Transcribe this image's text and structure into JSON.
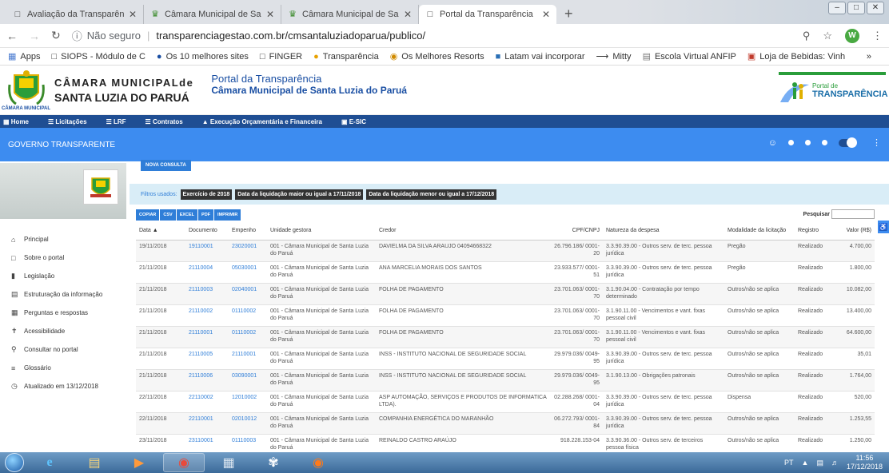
{
  "browser": {
    "tabs": [
      {
        "title": "Avaliação da Transparência dos M",
        "icon": "page-icon",
        "active": false
      },
      {
        "title": "Câmara Municipal de Santa Luzia",
        "icon": "crest-icon",
        "active": false
      },
      {
        "title": "Câmara Municipal de Santa Luzia",
        "icon": "crest-icon",
        "active": false
      },
      {
        "title": "Portal da Transparência",
        "icon": "page-icon",
        "active": true
      }
    ],
    "security_label": "Não seguro",
    "url": "transparenciagestao.com.br/cmsantaluziadoparua/publico/",
    "avatar_letter": "W",
    "bookmarks": [
      {
        "label": "Apps",
        "icon": "apps-icon"
      },
      {
        "label": "SIOPS - Módulo de C",
        "icon": "page-icon"
      },
      {
        "label": "Os 10 melhores sites",
        "icon": "globe-icon"
      },
      {
        "label": "FINGER",
        "icon": "page-icon"
      },
      {
        "label": "Transparência",
        "icon": "info-icon"
      },
      {
        "label": "Os Melhores Resorts",
        "icon": "resort-icon"
      },
      {
        "label": "Latam vai incorporar",
        "icon": "news-icon"
      },
      {
        "label": "Mitty",
        "icon": "arrow-icon"
      },
      {
        "label": "Escola Virtual ANFIP",
        "icon": "school-icon"
      },
      {
        "label": "Loja de Bebidas: Vinh",
        "icon": "store-icon"
      }
    ]
  },
  "header": {
    "org_line1": "CÂMARA MUNICIPALde",
    "org_line2": "SANTA LUZIA DO PARUÁ",
    "crest_caption": "CÂMARA MUNICIPAL",
    "portal_title": "Portal da Transparência",
    "portal_subtitle": "Câmara Municipal de Santa Luzia do Paruá",
    "brand_small": "Portal de",
    "brand_large": "TRANSPARÊNCIA"
  },
  "menu": {
    "items": [
      "Home",
      "Licitações",
      "LRF",
      "Contratos",
      "Execução Orçamentária e Financeira",
      "E-SIC"
    ]
  },
  "govbar": {
    "title": "GOVERNO TRANSPARENTE"
  },
  "sidebar": {
    "items": [
      {
        "label": "Principal",
        "icon": "home-icon"
      },
      {
        "label": "Sobre o portal",
        "icon": "folder-icon"
      },
      {
        "label": "Legislação",
        "icon": "document-icon"
      },
      {
        "label": "Estruturação da informação",
        "icon": "structure-icon"
      },
      {
        "label": "Perguntas e respostas",
        "icon": "question-icon"
      },
      {
        "label": "Acessibilidade",
        "icon": "accessibility-icon"
      },
      {
        "label": "Consultar no portal",
        "icon": "search-icon"
      },
      {
        "label": "Glossário",
        "icon": "list-icon"
      },
      {
        "label": "Atualizado em 13/12/2018",
        "icon": "clock-icon"
      }
    ]
  },
  "main": {
    "new_query": "NOVA CONSULTA",
    "filters_label": "Filtros usados:",
    "filters": [
      "Exercício de 2018",
      "Data da liquidação maior ou igual a 17/11/2018",
      "Data da liquidação menor ou igual a 17/12/2018"
    ],
    "export_buttons": [
      "COPIAR",
      "CSV",
      "EXCEL",
      "PDF",
      "IMPRIMIR"
    ],
    "search_label": "Pesquisar",
    "columns": [
      "Data",
      "Documento",
      "Empenho",
      "Unidade gestora",
      "Credor",
      "CPF/CNPJ",
      "Natureza da despesa",
      "Modalidade da licitação",
      "Registro",
      "Valor (R$)"
    ],
    "rows": [
      [
        "19/11/2018",
        "19110001",
        "23020001",
        "001 - Câmara Municipal de Santa Luzia do Paruá",
        "DAVIELMA DA SILVA ARAUJO 04094668322",
        "26.796.186/ 0001-20",
        "3.3.90.39.00 - Outros serv. de terc. pessoa jurídica",
        "Pregão",
        "Realizado",
        "4.700,00"
      ],
      [
        "21/11/2018",
        "21110004",
        "05030001",
        "001 - Câmara Municipal de Santa Luzia do Paruá",
        "ANA MARCELIA MORAIS DOS SANTOS",
        "23.933.577/ 0001-51",
        "3.3.90.39.00 - Outros serv. de terc. pessoa jurídica",
        "Pregão",
        "Realizado",
        "1.800,00"
      ],
      [
        "21/11/2018",
        "21110003",
        "02040001",
        "001 - Câmara Municipal de Santa Luzia do Paruá",
        "FOLHA DE PAGAMENTO",
        "23.701.063/ 0001-70",
        "3.1.90.04.00 - Contratação por tempo determinado",
        "Outros/não se aplica",
        "Realizado",
        "10.082,00"
      ],
      [
        "21/11/2018",
        "21110002",
        "01110002",
        "001 - Câmara Municipal de Santa Luzia do Paruá",
        "FOLHA DE PAGAMENTO",
        "23.701.063/ 0001-70",
        "3.1.90.11.00 - Vencimentos e vant. fixas pessoal civil",
        "Outros/não se aplica",
        "Realizado",
        "13.400,00"
      ],
      [
        "21/11/2018",
        "21110001",
        "01110002",
        "001 - Câmara Municipal de Santa Luzia do Paruá",
        "FOLHA DE PAGAMENTO",
        "23.701.063/ 0001-70",
        "3.1.90.11.00 - Vencimentos e vant. fixas pessoal civil",
        "Outros/não se aplica",
        "Realizado",
        "64.600,00"
      ],
      [
        "21/11/2018",
        "21110005",
        "21110001",
        "001 - Câmara Municipal de Santa Luzia do Paruá",
        "INSS - INSTITUTO NACIONAL DE SEGURIDADE SOCIAL",
        "29.979.036/ 0049-95",
        "3.3.90.39.00 - Outros serv. de terc. pessoa jurídica",
        "Outros/não se aplica",
        "Realizado",
        "35,01"
      ],
      [
        "21/11/2018",
        "21110006",
        "03090001",
        "001 - Câmara Municipal de Santa Luzia do Paruá",
        "INSS - INSTITUTO NACIONAL DE SEGURIDADE SOCIAL",
        "29.979.036/ 0049-95",
        "3.1.90.13.00 - Obrigações patronais",
        "Outros/não se aplica",
        "Realizado",
        "1.764,00"
      ],
      [
        "22/11/2018",
        "22110002",
        "12010002",
        "001 - Câmara Municipal de Santa Luzia do Paruá",
        "ASP AUTOMAÇÃO, SERVIÇOS E PRODUTOS DE INFORMATICA LTDA).",
        "02.288.268/ 0001-04",
        "3.3.90.39.00 - Outros serv. de terc. pessoa jurídica",
        "Dispensa",
        "Realizado",
        "520,00"
      ],
      [
        "22/11/2018",
        "22110001",
        "02010012",
        "001 - Câmara Municipal de Santa Luzia do Paruá",
        "COMPANHIA ENERGÉTICA DO MARANHÃO",
        "06.272.793/ 0001-84",
        "3.3.90.39.00 - Outros serv. de terc. pessoa jurídica",
        "Outros/não se aplica",
        "Realizado",
        "1.253,55"
      ],
      [
        "23/11/2018",
        "23110001",
        "01110003",
        "001 - Câmara Municipal de Santa Luzia do Paruá",
        "REINALDO CASTRO ARAÚJO",
        "918.228.153-04",
        "3.3.90.36.00 - Outros serv. de terceiros pessoa física",
        "Outros/não se aplica",
        "Realizado",
        "1.250,00"
      ]
    ]
  },
  "taskbar": {
    "lang": "PT",
    "time": "11:56",
    "date": "17/12/2018"
  }
}
